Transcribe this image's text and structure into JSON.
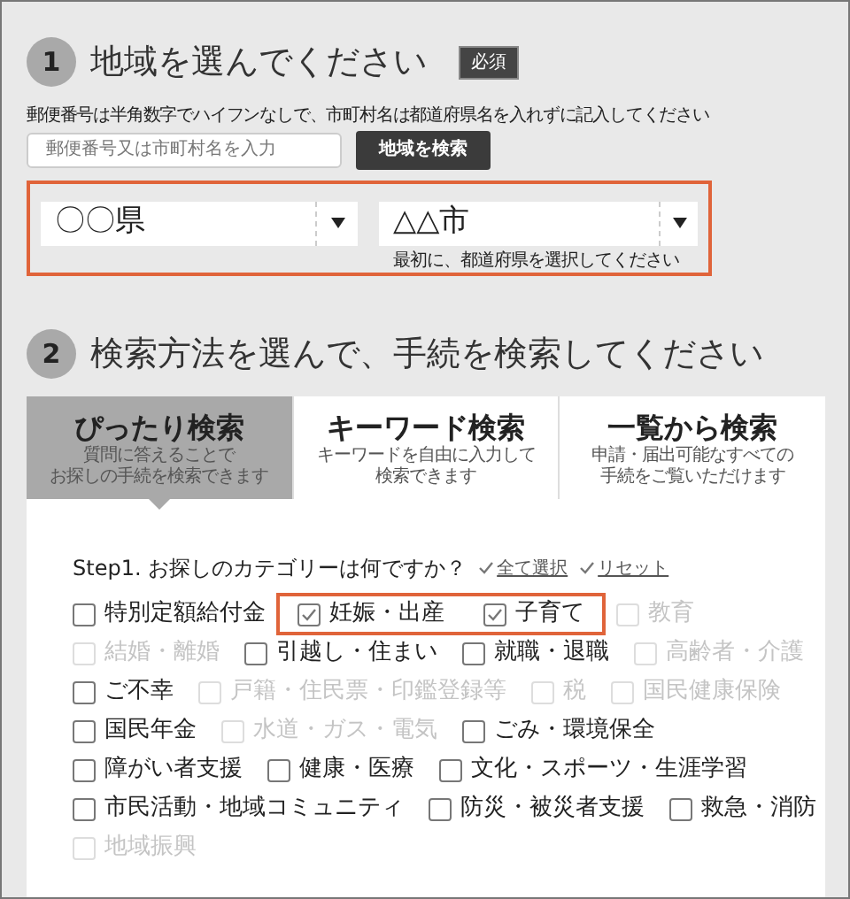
{
  "section1": {
    "number": "1",
    "title": "地域を選んでください",
    "badge": "必須",
    "note": "郵便番号は半角数字でハイフンなしで、市町村名は都道府県名を入れずに記入してください",
    "search": {
      "placeholder": "郵便番号又は市町村名を入力"
    },
    "search_button": "地域を検索",
    "region": {
      "highlighted": true,
      "prefecture": "〇〇県",
      "city": "△△市",
      "city_hint": "最初に、都道府県を選択してください"
    }
  },
  "section2": {
    "number": "2",
    "title": "検索方法を選んで、手続を検索してください",
    "tabs": [
      {
        "label": "ぴったり検索",
        "sub": [
          "質問に答えることで",
          "お探しの手続を検索できます"
        ],
        "selected": true
      },
      {
        "label": "キーワード検索",
        "sub": [
          "キーワードを自由に入力して",
          "検索できます"
        ],
        "selected": false
      },
      {
        "label": "一覧から検索",
        "sub": [
          "申請・届出可能なすべての",
          "手続をご覧いただけます"
        ],
        "selected": false
      }
    ],
    "step": {
      "question": "Step1. お探しのカテゴリーは何ですか？",
      "select_all": "全て選択",
      "reset": "リセット"
    },
    "category_rows": [
      [
        {
          "label": "特別定額給付金",
          "checked": false,
          "disabled": false,
          "highlighted": false
        },
        {
          "label": "妊娠・出産",
          "checked": true,
          "disabled": false,
          "highlighted": true
        },
        {
          "label": "子育て",
          "checked": true,
          "disabled": false,
          "highlighted": true
        },
        {
          "label": "教育",
          "checked": false,
          "disabled": true,
          "highlighted": false
        }
      ],
      [
        {
          "label": "結婚・離婚",
          "checked": false,
          "disabled": true,
          "highlighted": false
        },
        {
          "label": "引越し・住まい",
          "checked": false,
          "disabled": false,
          "highlighted": false
        },
        {
          "label": "就職・退職",
          "checked": false,
          "disabled": false,
          "highlighted": false
        },
        {
          "label": "高齢者・介護",
          "checked": false,
          "disabled": true,
          "highlighted": false
        }
      ],
      [
        {
          "label": "ご不幸",
          "checked": false,
          "disabled": false,
          "highlighted": false
        },
        {
          "label": "戸籍・住民票・印鑑登録等",
          "checked": false,
          "disabled": true,
          "highlighted": false
        },
        {
          "label": "税",
          "checked": false,
          "disabled": true,
          "highlighted": false
        },
        {
          "label": "国民健康保険",
          "checked": false,
          "disabled": true,
          "highlighted": false
        }
      ],
      [
        {
          "label": "国民年金",
          "checked": false,
          "disabled": false,
          "highlighted": false
        },
        {
          "label": "水道・ガス・電気",
          "checked": false,
          "disabled": true,
          "highlighted": false
        },
        {
          "label": "ごみ・環境保全",
          "checked": false,
          "disabled": false,
          "highlighted": false
        }
      ],
      [
        {
          "label": "障がい者支援",
          "checked": false,
          "disabled": false,
          "highlighted": false
        },
        {
          "label": "健康・医療",
          "checked": false,
          "disabled": false,
          "highlighted": false
        },
        {
          "label": "文化・スポーツ・生涯学習",
          "checked": false,
          "disabled": false,
          "highlighted": false
        }
      ],
      [
        {
          "label": "市民活動・地域コミュニティ",
          "checked": false,
          "disabled": false,
          "highlighted": false
        },
        {
          "label": "防災・被災者支援",
          "checked": false,
          "disabled": false,
          "highlighted": false
        },
        {
          "label": "救急・消防",
          "checked": false,
          "disabled": false,
          "highlighted": false
        }
      ],
      [
        {
          "label": "地域振興",
          "checked": false,
          "disabled": true,
          "highlighted": false
        }
      ]
    ]
  }
}
